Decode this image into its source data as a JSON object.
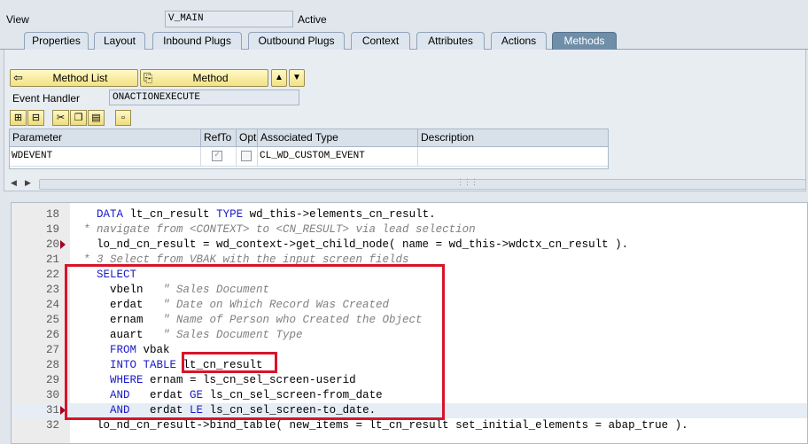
{
  "header": {
    "view_label": "View",
    "view_value": "V_MAIN",
    "status": "Active"
  },
  "tabs": [
    {
      "label": "Properties"
    },
    {
      "label": "Layout"
    },
    {
      "label": "Inbound Plugs"
    },
    {
      "label": "Outbound Plugs"
    },
    {
      "label": "Context"
    },
    {
      "label": "Attributes"
    },
    {
      "label": "Actions"
    },
    {
      "label": "Methods"
    }
  ],
  "active_tab": "Methods",
  "buttons": {
    "method_list": "Method List",
    "method": "Method"
  },
  "event_handler": {
    "label": "Event Handler",
    "value": "ONACTIONEXECUTE"
  },
  "grid": {
    "columns": [
      "Parameter",
      "RefTo",
      "Opt",
      "Associated Type",
      "Description"
    ],
    "rows": [
      {
        "parameter": "WDEVENT",
        "refto": true,
        "opt": false,
        "type": "CL_WD_CUSTOM_EVENT",
        "description": ""
      }
    ]
  },
  "code": [
    {
      "n": "18",
      "bp": false,
      "parts": [
        [
          "",
          "  "
        ],
        [
          "kw",
          "DATA"
        ],
        [
          "",
          " lt_cn_result "
        ],
        [
          "kw",
          "TYPE"
        ],
        [
          "",
          " wd_this->elements_cn_result."
        ]
      ]
    },
    {
      "n": "19",
      "bp": false,
      "parts": [
        [
          "cm",
          "* navigate from <CONTEXT> to <CN_RESULT> via lead selection"
        ]
      ]
    },
    {
      "n": "20",
      "bp": true,
      "parts": [
        [
          "",
          "  lo_nd_cn_result = wd_context->get_child_node( name = wd_this->wdctx_cn_result )."
        ]
      ]
    },
    {
      "n": "21",
      "bp": false,
      "parts": [
        [
          "cm",
          "* 3 Select from VBAK with the input screen fields"
        ]
      ]
    },
    {
      "n": "22",
      "bp": false,
      "parts": [
        [
          "",
          "  "
        ],
        [
          "kw",
          "SELECT"
        ]
      ]
    },
    {
      "n": "23",
      "bp": false,
      "parts": [
        [
          "",
          "    vbeln   "
        ],
        [
          "cm",
          "\" Sales Document"
        ]
      ]
    },
    {
      "n": "24",
      "bp": false,
      "parts": [
        [
          "",
          "    erdat   "
        ],
        [
          "cm",
          "\" Date on Which Record Was Created"
        ]
      ]
    },
    {
      "n": "25",
      "bp": false,
      "parts": [
        [
          "",
          "    ernam   "
        ],
        [
          "cm",
          "\" Name of Person who Created the Object"
        ]
      ]
    },
    {
      "n": "26",
      "bp": false,
      "parts": [
        [
          "",
          "    auart   "
        ],
        [
          "cm",
          "\" Sales Document Type"
        ]
      ]
    },
    {
      "n": "27",
      "bp": false,
      "parts": [
        [
          "",
          "    "
        ],
        [
          "kw",
          "FROM"
        ],
        [
          "",
          " vbak"
        ]
      ]
    },
    {
      "n": "28",
      "bp": false,
      "parts": [
        [
          "",
          "    "
        ],
        [
          "kw",
          "INTO TABLE"
        ],
        [
          "",
          " lt_cn_result"
        ]
      ]
    },
    {
      "n": "29",
      "bp": false,
      "parts": [
        [
          "",
          "    "
        ],
        [
          "kw",
          "WHERE"
        ],
        [
          "",
          " ernam = ls_cn_sel_screen-userid"
        ]
      ]
    },
    {
      "n": "30",
      "bp": false,
      "parts": [
        [
          "",
          "    "
        ],
        [
          "kw",
          "AND"
        ],
        [
          "",
          "   erdat "
        ],
        [
          "kw",
          "GE"
        ],
        [
          "",
          " ls_cn_sel_screen-from_date"
        ]
      ]
    },
    {
      "n": "31",
      "bp": true,
      "hl": true,
      "parts": [
        [
          "",
          "    "
        ],
        [
          "kw",
          "AND"
        ],
        [
          "",
          "   erdat "
        ],
        [
          "kw",
          "LE"
        ],
        [
          "",
          " ls_cn_sel_screen-to_date."
        ]
      ]
    },
    {
      "n": "32",
      "bp": false,
      "parts": [
        [
          "",
          "  lo_nd_cn_result->bind_table( new_items = lt_cn_result set_initial_elements = abap_true )."
        ]
      ]
    }
  ],
  "colors": {
    "keyword": "#1a1ac8",
    "comment": "#808080",
    "highlight_box": "#d8142a",
    "active_tab": "#6f8ea8"
  }
}
